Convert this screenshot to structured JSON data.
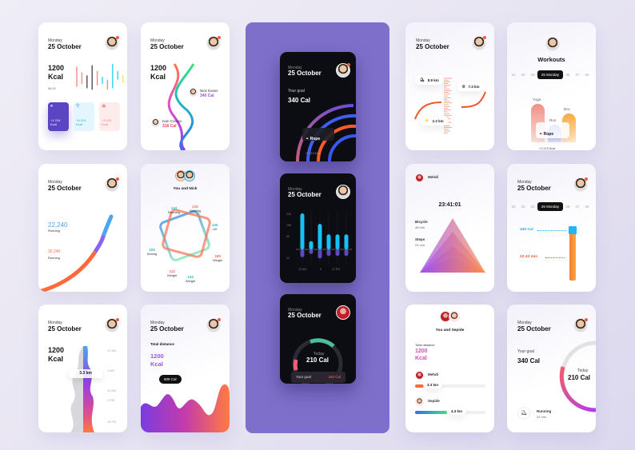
{
  "common": {
    "day": "Monday",
    "date": "25 October"
  },
  "card1": {
    "kcal_value": "1200",
    "kcal_unit": "Kcal",
    "time": "06:21",
    "bars": [
      {
        "color": "#f28b82",
        "top": 0.15,
        "bottom": 0.85
      },
      {
        "color": "#f28b82",
        "top": 0.35,
        "bottom": 0.75
      },
      {
        "color": "#4a4a6a",
        "top": 0.45,
        "bottom": 0.9
      },
      {
        "color": "#4a4a6a",
        "top": 0.1,
        "bottom": 0.95
      },
      {
        "color": "#f28b82",
        "top": 0.3,
        "bottom": 0.8
      },
      {
        "color": "#2fd3f0",
        "top": 0.5,
        "bottom": 0.75
      },
      {
        "color": "#f28b82",
        "top": 0.6,
        "bottom": 0.95
      },
      {
        "color": "#2fd3f0",
        "top": 0.05,
        "bottom": 0.9
      },
      {
        "color": "#2fd3f0",
        "top": 0.3,
        "bottom": 0.6
      },
      {
        "color": "#f7e35a",
        "top": 0.45,
        "bottom": 0.7
      }
    ],
    "tiles": [
      {
        "icon": "dumbbell-icon",
        "glyph": "⏸",
        "value": "+1 213",
        "unit": "Kcal",
        "bg": "#5b45c2",
        "fg": "#ffffff"
      },
      {
        "icon": "kettlebell-icon",
        "glyph": "⚲",
        "value": "+6 113",
        "unit": "Kcal",
        "bg": "#e3f6fd",
        "fg": "#24a3d6"
      },
      {
        "icon": "treadmill-icon",
        "glyph": "⏏",
        "value": "+3 223",
        "unit": "Kcal",
        "bg": "#fdecec",
        "fg": "#f07a7a"
      }
    ]
  },
  "card2": {
    "kcal_value": "1200",
    "kcal_unit": "Kcal",
    "people": [
      {
        "name": "Nick Evans",
        "cal": "340 Cal"
      },
      {
        "name": "Ivan Conejo",
        "cal": "316 Cal"
      }
    ]
  },
  "card3": {
    "goal_label": "Your goal",
    "goal_value": "340 Cal",
    "activity": "Rope",
    "activity_value": "+1 213 Kcal"
  },
  "card4": {
    "chart_data": {
      "type": "bar",
      "y_ticks": [
        "240",
        "168",
        "85",
        "44"
      ],
      "x_ticks": [
        "12 AM",
        "6",
        "12 PM"
      ],
      "series": [
        {
          "name": "positive",
          "color": "#17c1f5",
          "values": [
            240,
            55,
            170,
            100,
            100,
            100
          ]
        },
        {
          "name": "negative",
          "color": "#5d48c4",
          "values": [
            -95,
            -55,
            -110,
            -80,
            -80,
            -80
          ]
        }
      ]
    }
  },
  "card5": {
    "today_label": "Today",
    "today_value": "210 Cal",
    "goal_label": "Your goal",
    "goal_value": "340 Cal"
  },
  "card6": {
    "items": [
      {
        "icon": "shoe-icon",
        "glyph": "⛸",
        "value": "8.9 km"
      },
      {
        "icon": "timer-icon",
        "glyph": "⏱",
        "value": "7.3 km"
      },
      {
        "icon": "run-icon",
        "glyph": "⚡",
        "value": "2.2 km"
      }
    ]
  },
  "card7": {
    "title": "Workouts",
    "days": [
      "22",
      "23",
      "24",
      "25 Monday",
      "26",
      "27",
      "28"
    ],
    "selected_day": "25 Monday",
    "bars": [
      {
        "label": "Yoga",
        "value": 1.0,
        "color_top": "#f08f84",
        "color_bottom": "#fde2dd"
      },
      {
        "label": "Run",
        "value": 0.45,
        "color_top": "#6a6cf0",
        "color_bottom": "#e6e6ff"
      },
      {
        "label": "Box",
        "value": 0.75,
        "color_top": "#f7a93c",
        "color_bottom": "#ffe9c9"
      }
    ],
    "tooltip_title": "Rope",
    "tooltip_value": "+1 213 Kcal"
  },
  "card8": {
    "primary_value": "22,240",
    "primary_label": "Running",
    "primary_color": "#4aa6f0",
    "secondary_value": "32,240",
    "secondary_label": "Running",
    "secondary_color": "#ff6a3c"
  },
  "card9": {
    "title": "You and Nick",
    "metrics": [
      {
        "value": "143",
        "label": "Running",
        "color": "#26b7c9"
      },
      {
        "value": "215",
        "label": "Walking",
        "color": "#ff6a4d"
      },
      {
        "value": "130",
        "label": "Lift",
        "color": "#26b7c9"
      },
      {
        "value": "180",
        "label": "Weight",
        "color": "#ff6a4d"
      },
      {
        "value": "132",
        "label": "Weight",
        "color": "#26b7c9"
      },
      {
        "value": "112",
        "label": "Weight",
        "color": "#ff6a4d"
      },
      {
        "value": "100",
        "label": "Boxing",
        "color": "#26b7c9"
      }
    ]
  },
  "card10": {
    "user": "Mehdi",
    "timer": "23:41:01",
    "stats": [
      {
        "label": "Bicycle",
        "value": "48 min"
      },
      {
        "label": "Steps",
        "value": "24 min"
      }
    ]
  },
  "card11": {
    "days": [
      "22",
      "23",
      "24",
      "25 Monday",
      "26",
      "27",
      "28"
    ],
    "cal_value": "340 Cal",
    "min_value": "22:43 min"
  },
  "card12": {
    "kcal_value": "1200",
    "kcal_unit": "Kcal",
    "distance": "3.3 km",
    "times": [
      "12 AM",
      "4 AM",
      "10 AM",
      "1 PM",
      "18 PM"
    ]
  },
  "card13": {
    "label": "Total distance",
    "kcal_value": "1200",
    "kcal_unit": "Kcal",
    "badge": "809 Cal"
  },
  "card14": {
    "title": "You and Sepide",
    "label": "Total distance",
    "kcal_value": "1200",
    "kcal_unit": "Kcal",
    "people": [
      {
        "name": "Mehdi",
        "value": "3.3 km",
        "progress": 0.12
      },
      {
        "name": "Sepide",
        "value": "4.3 km",
        "progress": 0.45
      }
    ]
  },
  "card15": {
    "goal_label": "Your goal",
    "goal_value": "340 Cal",
    "today_label": "Today",
    "today_value": "210 Cal",
    "activity": "Running",
    "activity_time": "24 min"
  }
}
